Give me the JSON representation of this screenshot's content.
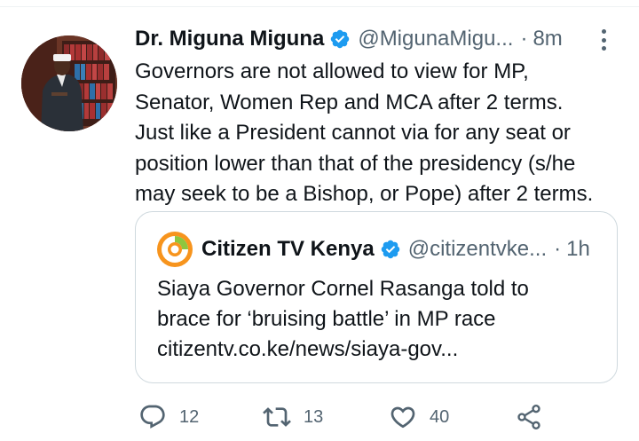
{
  "tweet": {
    "author_name": "Dr. Miguna Miguna",
    "handle": "@MigunaMigu...",
    "separator": "·",
    "time": "8m",
    "body_lines": [
      "Governors are not allowed to view for MP,",
      "Senator, Women Rep and MCA after 2 terms.",
      "Just like a President cannot via for any seat or",
      "position lower than that of the presidency (s/he",
      "may seek to be a Bishop, or Pope) after 2 terms."
    ]
  },
  "quoted": {
    "author_name": "Citizen TV Kenya",
    "handle": "@citizentvke...",
    "separator": "·",
    "time": "1h",
    "text_lines": [
      "Siaya Governor Cornel Rasanga told to",
      "brace for ‘bruising battle’ in MP race",
      "citizentv.co.ke/news/siaya-gov..."
    ]
  },
  "actions": {
    "replies": "12",
    "retweets": "13",
    "likes": "40"
  },
  "icons": {
    "verified": "verified-badge-icon",
    "more": "more-options-icon",
    "reply": "reply-icon",
    "retweet": "retweet-icon",
    "like": "heart-icon",
    "share": "share-icon"
  },
  "colors": {
    "verified": "#1d9bf0",
    "text": "#0f1419",
    "secondary": "#536471",
    "border": "#cfd9de",
    "citizen_orange": "#f7941d",
    "citizen_green": "#8dc63f"
  }
}
